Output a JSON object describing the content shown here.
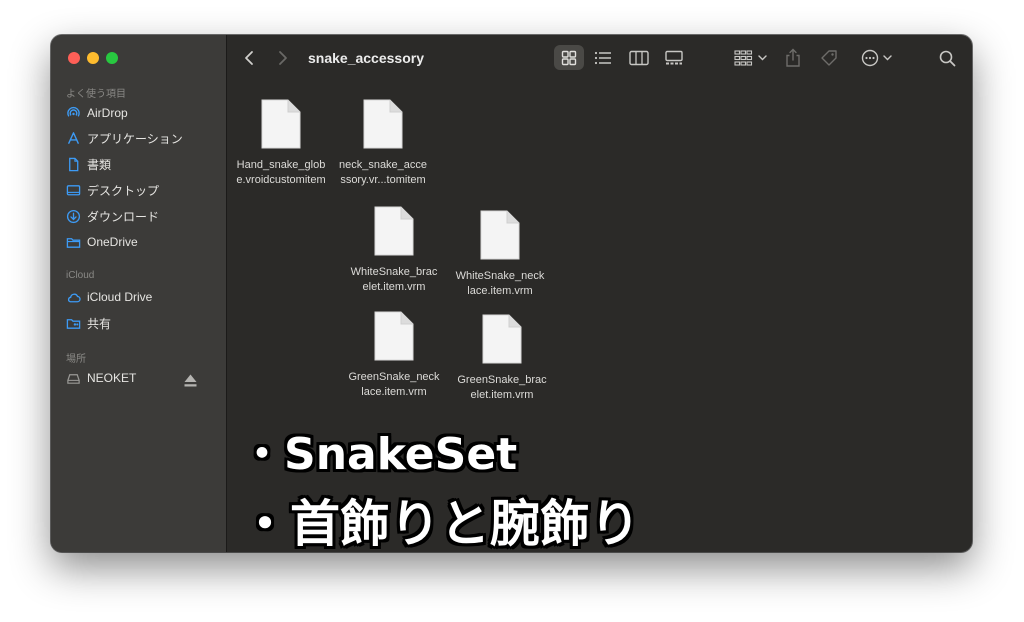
{
  "window": {
    "title": "snake_accessory"
  },
  "sidebar": {
    "favorites_label": "よく使う項目",
    "favorites": [
      {
        "label": "AirDrop",
        "icon": "airdrop-icon"
      },
      {
        "label": "アプリケーション",
        "icon": "applications-icon"
      },
      {
        "label": "書類",
        "icon": "document-icon"
      },
      {
        "label": "デスクトップ",
        "icon": "desktop-icon"
      },
      {
        "label": "ダウンロード",
        "icon": "download-icon"
      },
      {
        "label": "OneDrive",
        "icon": "folder-icon"
      }
    ],
    "icloud_label": "iCloud",
    "icloud": [
      {
        "label": "iCloud Drive",
        "icon": "cloud-icon"
      },
      {
        "label": "共有",
        "icon": "shared-folder-icon"
      }
    ],
    "locations_label": "場所",
    "locations": [
      {
        "label": "NEOKET",
        "icon": "drive-icon"
      }
    ]
  },
  "files": [
    {
      "name": "Hand_snake_globe.vroidcustomitem",
      "display": "Hand_snake_glob\ne.vroidcustomitem"
    },
    {
      "name": "neck_snake_accessory.vroidcustomitem",
      "display": "neck_snake_acce\nssory.vr...tomitem"
    },
    {
      "name": "WhiteSnake_bracelet.item.vrm",
      "display": "WhiteSnake_brac\nelet.item.vrm"
    },
    {
      "name": "WhiteSnake_necklace.item.vrm",
      "display": "WhiteSnake_neck\nlace.item.vrm"
    },
    {
      "name": "GreenSnake_necklace.item.vrm",
      "display": "GreenSnake_neck\nlace.item.vrm"
    },
    {
      "name": "GreenSnake_bracelet.item.vrm",
      "display": "GreenSnake_brac\nelet.item.vrm"
    }
  ],
  "overlay": {
    "line1": "・SnakeSet",
    "line2": "・首飾りと腕飾り"
  },
  "colors": {
    "window_bg": "#2b2a28",
    "sidebar_bg": "#3c3b39",
    "accent": "#3d9bf5",
    "close": "#fe5f57",
    "minimize": "#febc2e",
    "zoom": "#28c840"
  }
}
